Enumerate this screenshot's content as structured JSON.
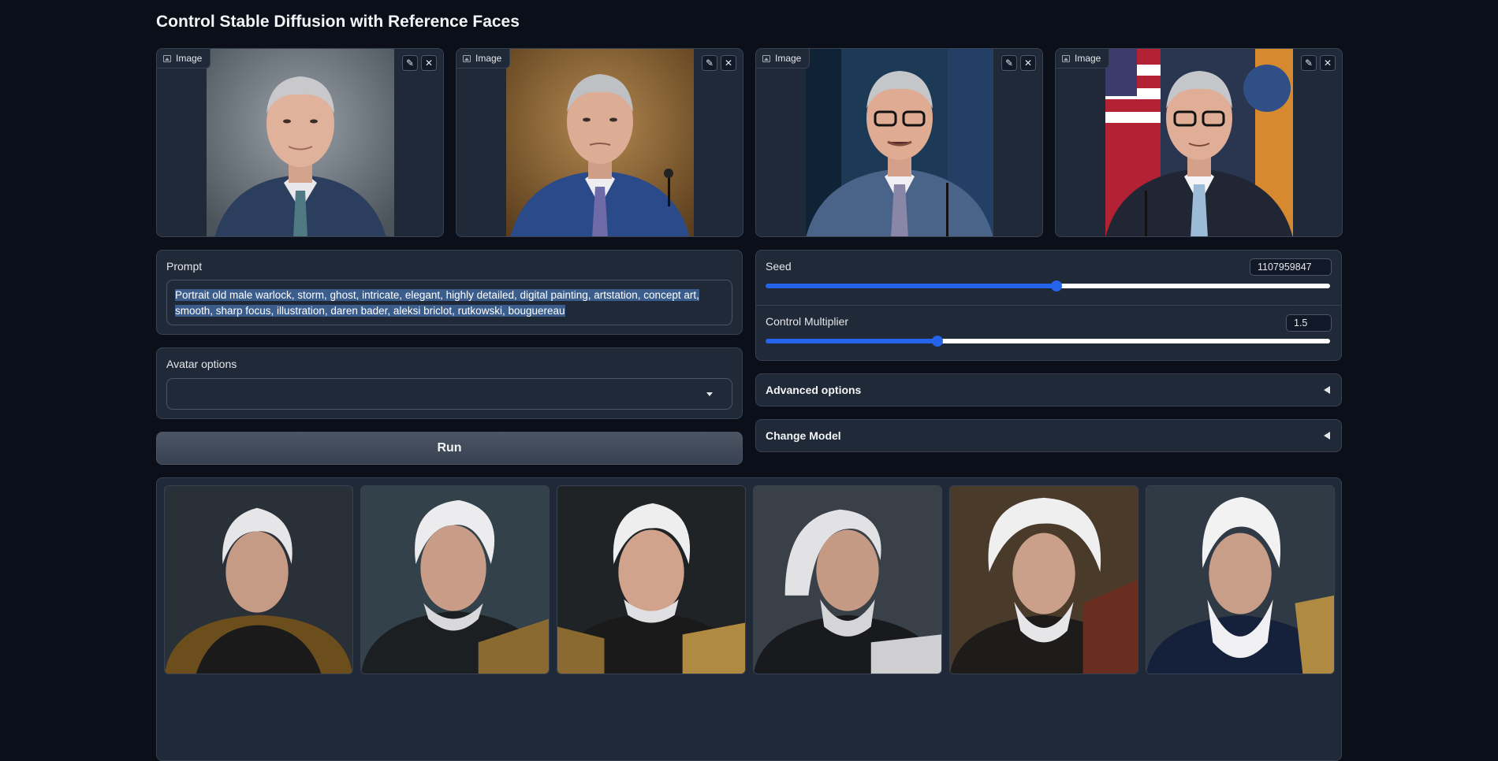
{
  "page": {
    "title": "Control Stable Diffusion with Reference Faces"
  },
  "reference_images": [
    {
      "label": "Image",
      "edit_icon": "pencil-icon",
      "clear_icon": "close-icon"
    },
    {
      "label": "Image",
      "edit_icon": "pencil-icon",
      "clear_icon": "close-icon"
    },
    {
      "label": "Image",
      "edit_icon": "pencil-icon",
      "clear_icon": "close-icon"
    },
    {
      "label": "Image",
      "edit_icon": "pencil-icon",
      "clear_icon": "close-icon"
    }
  ],
  "prompt": {
    "label": "Prompt",
    "value": "Portrait old male warlock, storm, ghost, intricate, elegant, highly detailed, digital painting, artstation, concept art, smooth, sharp focus, illustration, daren bader, aleksi briclot, rutkowski, bouguereau"
  },
  "avatar": {
    "label": "Avatar options",
    "selected": ""
  },
  "run_button": {
    "label": "Run"
  },
  "seed": {
    "label": "Seed",
    "value": "1107959847",
    "fraction": 0.516
  },
  "control_multiplier": {
    "label": "Control Multiplier",
    "value": "1.5",
    "fraction": 0.305
  },
  "advanced_options": {
    "label": "Advanced options"
  },
  "change_model": {
    "label": "Change Model"
  },
  "colors": {
    "background": "#0b0f19",
    "panel": "#1f2937",
    "accent": "#2563eb",
    "selection": "#3b5d8c"
  }
}
